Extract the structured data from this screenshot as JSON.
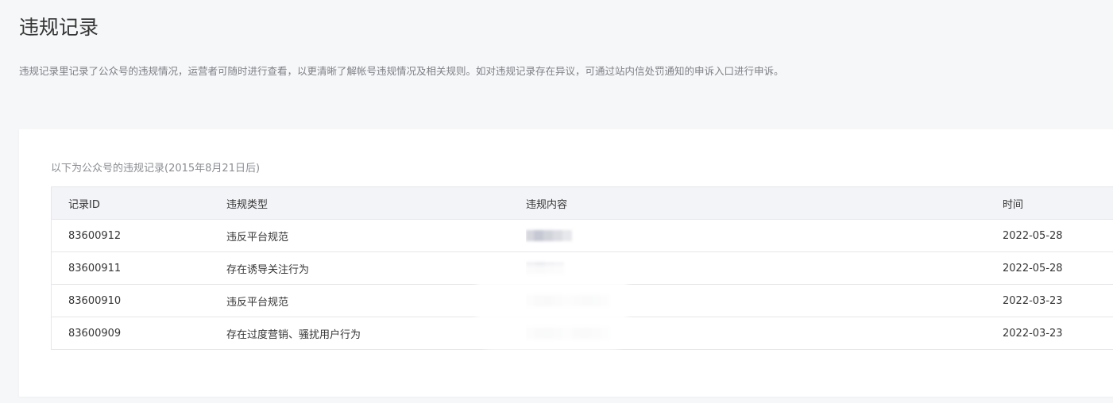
{
  "page": {
    "title": "违规记录",
    "description": "违规记录里记录了公众号的违规情况，运营者可随时进行查看，以更清晰了解帐号违规情况及相关规则。如对违规记录存在异议，可通过站内信处罚通知的申诉入口进行申诉。"
  },
  "records": {
    "caption": "以下为公众号的违规记录(2015年8月21日后)",
    "columns": {
      "id": "记录ID",
      "type": "违规类型",
      "content": "违规内容",
      "time": "时间"
    },
    "rows": [
      {
        "id": "83600912",
        "type": "违反平台规范",
        "content": "",
        "time": "2022-05-28"
      },
      {
        "id": "83600911",
        "type": "存在诱导关注行为",
        "content": "",
        "time": "2022-05-28"
      },
      {
        "id": "83600910",
        "type": "违反平台规范",
        "content": "",
        "time": "2022-03-23"
      },
      {
        "id": "83600909",
        "type": "存在过度营销、骚扰用户行为",
        "content": "",
        "time": "2022-03-23"
      }
    ]
  },
  "colors": {
    "page_background": "#f6f7f9",
    "card_background": "#ffffff",
    "header_background": "#f3f4f7",
    "border": "#e6e7eb",
    "mosaic_dark": "#c9cbd6",
    "mosaic_light": "#e3e4ea"
  }
}
